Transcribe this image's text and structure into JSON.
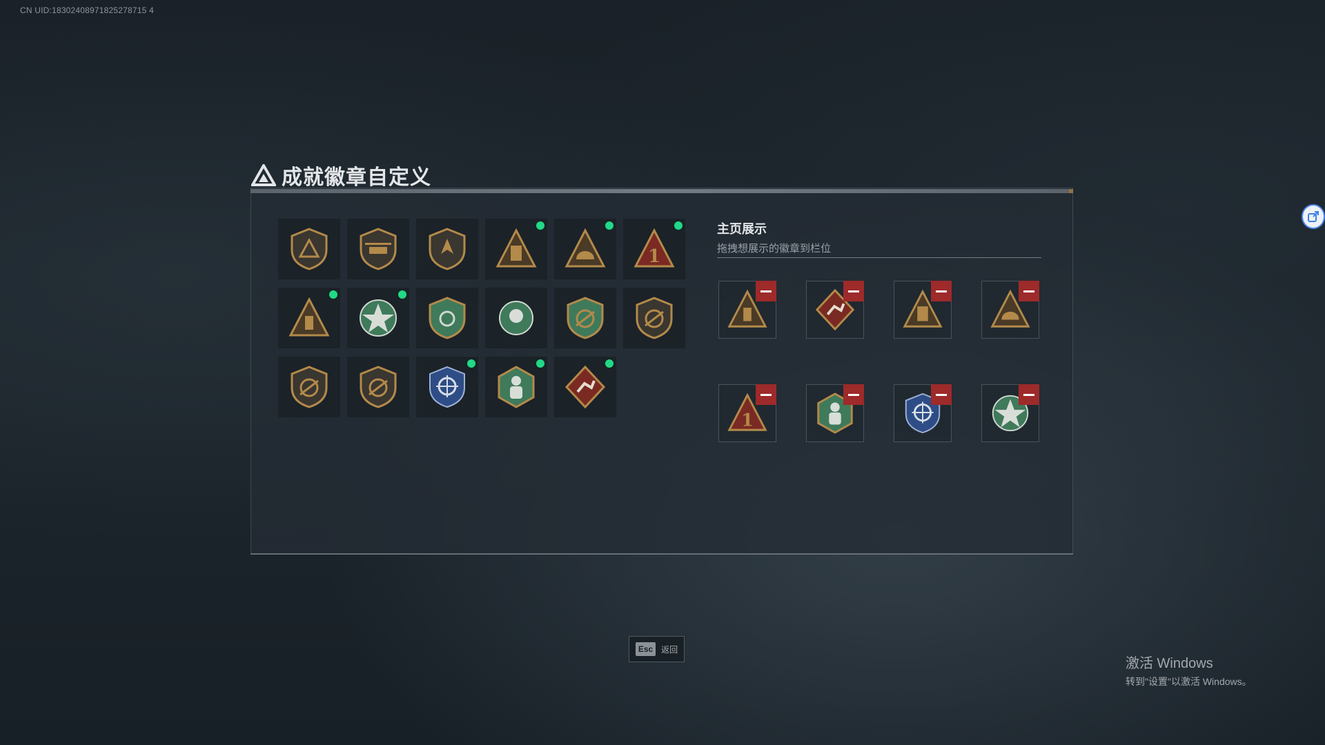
{
  "uid_text": "CN UID:18302408971825278715 4",
  "title": "成就徽章自定义",
  "badges": [
    {
      "icon": "pyramid-shield-badge-icon",
      "new": false
    },
    {
      "icon": "helicopter-shield-badge-icon",
      "new": false
    },
    {
      "icon": "bird-shield-badge-icon",
      "new": false
    },
    {
      "icon": "tower-triangle-badge-icon",
      "new": true
    },
    {
      "icon": "helmet-triangle-badge-icon",
      "new": true
    },
    {
      "icon": "number-one-triangle-badge-icon",
      "new": true
    },
    {
      "icon": "bottle-triangle-badge-icon",
      "new": true
    },
    {
      "icon": "star-skull-badge-icon",
      "new": true
    },
    {
      "icon": "green-shield-badge-icon",
      "new": false
    },
    {
      "icon": "skull-crossbones-badge-icon",
      "new": false
    },
    {
      "icon": "target-green-shield-badge-icon",
      "new": false
    },
    {
      "icon": "rifle-shield-badge-icon",
      "new": false
    },
    {
      "icon": "rifle-shield-badge-icon",
      "new": false
    },
    {
      "icon": "rifle-shield-badge-icon",
      "new": false
    },
    {
      "icon": "crosshair-blue-badge-icon",
      "new": true
    },
    {
      "icon": "soldier-hexagon-badge-icon",
      "new": true
    },
    {
      "icon": "runner-diamond-badge-icon",
      "new": true
    }
  ],
  "showcase": {
    "title": "主页展示",
    "subtitle": "拖拽想展示的徽章到栏位",
    "slots": [
      {
        "icon": "bottle-triangle-badge-icon"
      },
      {
        "icon": "runner-diamond-badge-icon"
      },
      {
        "icon": "tower-triangle-badge-icon"
      },
      {
        "icon": "helmet-triangle-badge-icon"
      },
      {
        "icon": "number-one-triangle-badge-icon"
      },
      {
        "icon": "soldier-hexagon-badge-icon"
      },
      {
        "icon": "crosshair-blue-badge-icon"
      },
      {
        "icon": "star-skull-badge-icon"
      }
    ]
  },
  "footer": {
    "esc_key": "Esc",
    "esc_label": "返回"
  },
  "windows_activation": {
    "line1": "激活 Windows",
    "line2": "转到\"设置\"以激活 Windows。"
  },
  "colors": {
    "new_dot": "#22d889",
    "remove": "#9e2a2a",
    "bronze": "#b38a4a",
    "green": "#3f7a5b",
    "blue": "#2e4d86"
  }
}
